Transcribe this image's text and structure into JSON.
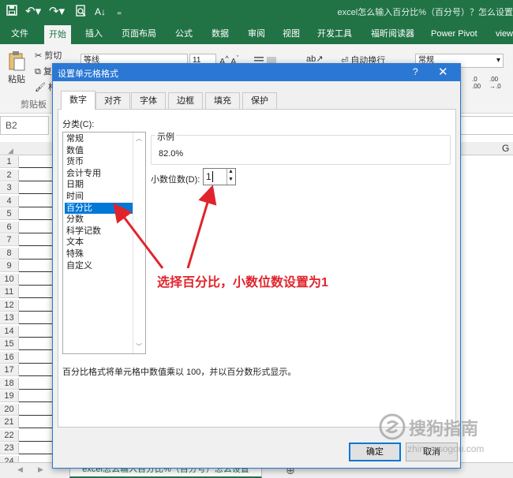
{
  "window": {
    "title": "excel怎么输入百分比%（百分号）？怎么设置"
  },
  "quick_access": {
    "sort_glyph": "A↓",
    "more_glyph": "₌"
  },
  "ribbon_tabs": [
    "文件",
    "开始",
    "插入",
    "页面布局",
    "公式",
    "数据",
    "审阅",
    "视图",
    "开发工具",
    "福昕阅读器",
    "Power Pivot",
    "view"
  ],
  "ribbon": {
    "cut": "剪切",
    "copy": "复",
    "format_painter": "格",
    "paste": "粘贴",
    "clipboard_group": "剪贴板",
    "font_name": "等线",
    "font_size": "11",
    "wrap_text": "自动换行",
    "number_format": "常规"
  },
  "name_box": "B2",
  "column_header_g": "G",
  "rows": [
    "1",
    "2",
    "3",
    "4",
    "5",
    "6",
    "7",
    "8",
    "9",
    "10",
    "11",
    "12",
    "13",
    "14",
    "15",
    "16",
    "17",
    "18",
    "19",
    "20",
    "21",
    "22",
    "23",
    "24"
  ],
  "sheet_tab": "excel怎么输入百分比%（百分号）怎么设置",
  "dialog": {
    "title": "设置单元格格式",
    "help": "?",
    "tabs": [
      "数字",
      "对齐",
      "字体",
      "边框",
      "填充",
      "保护"
    ],
    "category_label": "分类(C):",
    "categories": [
      "常规",
      "数值",
      "货币",
      "会计专用",
      "日期",
      "时间",
      "百分比",
      "分数",
      "科学记数",
      "文本",
      "特殊",
      "自定义"
    ],
    "selected_index": 6,
    "sample_label": "示例",
    "sample_value": "82.0%",
    "decimal_label": "小数位数(D):",
    "decimal_value": "1",
    "description": "百分比格式将单元格中数值乘以 100，并以百分数形式显示。",
    "ok": "确定",
    "cancel": "取消"
  },
  "annotation": "选择百分比，小数位数设置为1",
  "watermark": {
    "brand": "搜狗指南",
    "url": "zhinan.sogou.com"
  }
}
